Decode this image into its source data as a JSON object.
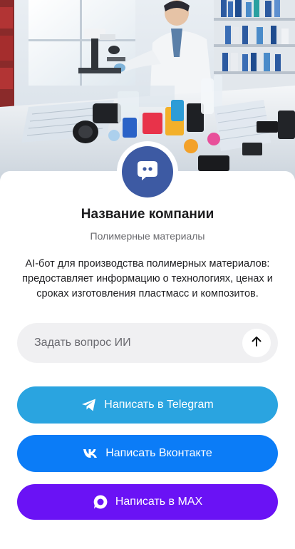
{
  "company": {
    "name": "Название компании",
    "category": "Полимерные материалы",
    "description": "AI-бот для производства полимерных материалов: предоставляет информацию о технологиях, ценах и сроках изготовления пластмасс и композитов."
  },
  "ask": {
    "placeholder": "Задать вопрос ИИ",
    "send_icon": "arrow-up-icon"
  },
  "buttons": {
    "telegram": {
      "label": "Написать в Telegram",
      "icon": "telegram-icon",
      "color": "#2aa4e0"
    },
    "vk": {
      "label": "Написать Вконтакте",
      "icon": "vk-icon",
      "color": "#0b7cf7"
    },
    "max": {
      "label": "Написать в MAX",
      "icon": "max-icon",
      "color": "#6a12f5"
    }
  },
  "avatar": {
    "icon": "chat-bot-icon",
    "color": "#3d5aa3"
  }
}
